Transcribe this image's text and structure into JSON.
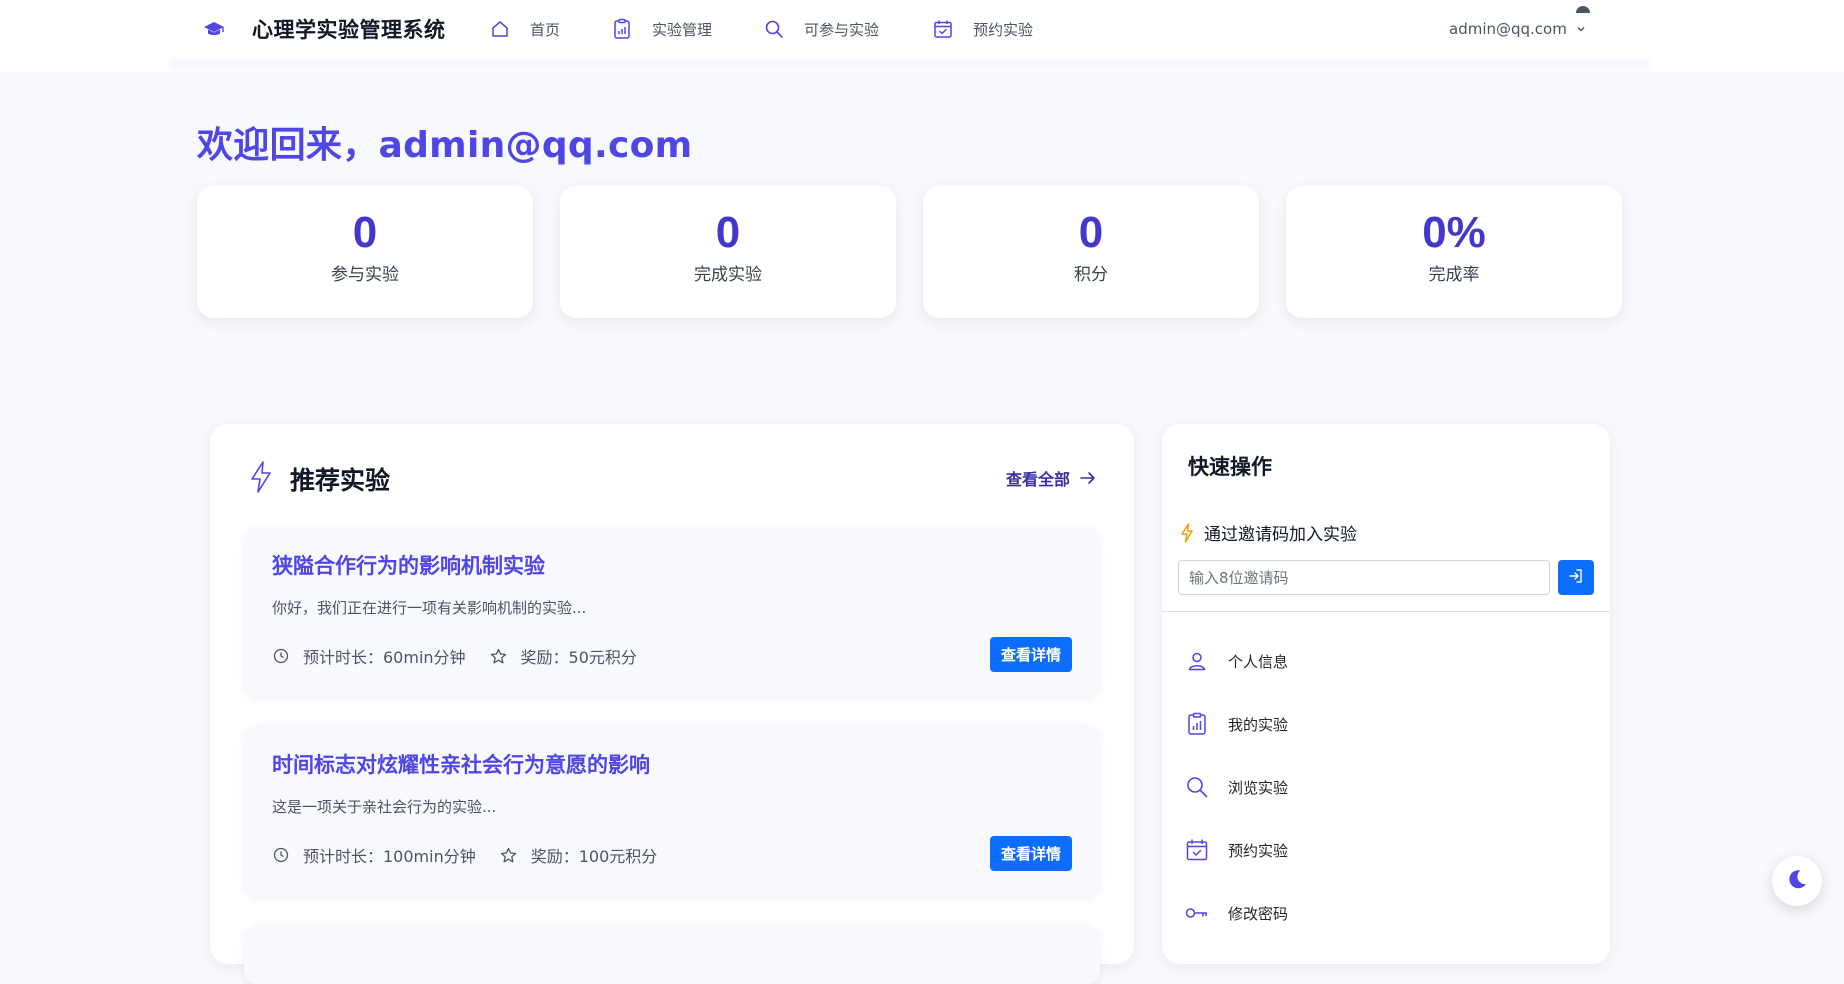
{
  "header": {
    "brand_title": "心理学实验管理系统",
    "nav": [
      {
        "label": "首页",
        "icon": "home-icon"
      },
      {
        "label": "实验管理",
        "icon": "clipboard-icon"
      },
      {
        "label": "可参与实验",
        "icon": "search-icon"
      },
      {
        "label": "预约实验",
        "icon": "calendar-check-icon"
      }
    ],
    "user_email": "admin@qq.com"
  },
  "welcome": "欢迎回来，admin@qq.com",
  "stats": [
    {
      "value": "0",
      "label": "参与实验"
    },
    {
      "value": "0",
      "label": "完成实验"
    },
    {
      "value": "0",
      "label": "积分"
    },
    {
      "value": "0%",
      "label": "完成率"
    }
  ],
  "recommended": {
    "title": "推荐实验",
    "view_all": "查看全部",
    "items": [
      {
        "title": "狭隘合作行为的影响机制实验",
        "desc": "你好，我们正在进行一项有关影响机制的实验...",
        "duration": "预计时长：60min分钟",
        "reward": "奖励：50元积分",
        "button": "查看详情"
      },
      {
        "title": "时间标志对炫耀性亲社会行为意愿的影响",
        "desc": "这是一项关于亲社会行为的实验...",
        "duration": "预计时长：100min分钟",
        "reward": "奖励：100元积分",
        "button": "查看详情"
      }
    ]
  },
  "quick": {
    "title": "快速操作",
    "invite_label": "通过邀请码加入实验",
    "invite_placeholder": "输入8位邀请码",
    "items": [
      {
        "label": "个人信息",
        "icon": "user-icon"
      },
      {
        "label": "我的实验",
        "icon": "clipboard-data-icon"
      },
      {
        "label": "浏览实验",
        "icon": "search-icon"
      },
      {
        "label": "预约实验",
        "icon": "calendar-check-icon"
      },
      {
        "label": "修改密码",
        "icon": "key-icon"
      }
    ]
  },
  "colors": {
    "primary": "#4f46e5",
    "button_blue": "#0d6efd",
    "background": "#f8f9fc",
    "accent_bolt": "#f59e0b"
  }
}
